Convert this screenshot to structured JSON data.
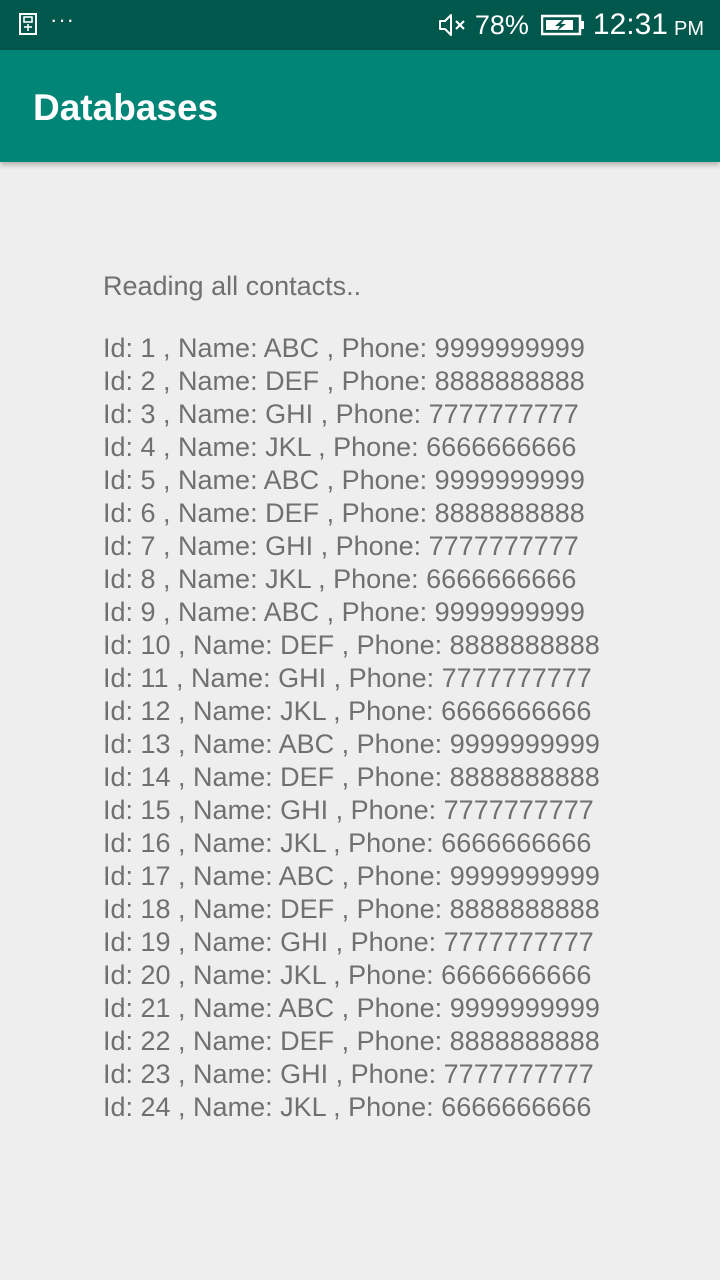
{
  "status_bar": {
    "icons_left": [
      "usb-icon",
      "more-dots-icon"
    ],
    "icons_right": [
      "mute-icon",
      "battery-charging-icon"
    ],
    "battery": "78%",
    "time": "12:31",
    "ampm": "PM"
  },
  "app_bar": {
    "title": "Databases",
    "color": "#008577"
  },
  "content": {
    "heading": "Reading all contacts..",
    "contacts": [
      "Id: 1 , Name: ABC , Phone: 9999999999",
      "Id: 2 , Name: DEF , Phone: 8888888888",
      "Id: 3 , Name: GHI , Phone: 7777777777",
      "Id: 4 , Name: JKL , Phone: 6666666666",
      "Id: 5 , Name: ABC , Phone: 9999999999",
      "Id: 6 , Name: DEF , Phone: 8888888888",
      "Id: 7 , Name: GHI , Phone: 7777777777",
      "Id: 8 , Name: JKL , Phone: 6666666666",
      "Id: 9 , Name: ABC , Phone: 9999999999",
      "Id: 10 , Name: DEF , Phone: 8888888888",
      "Id: 11 , Name: GHI , Phone: 7777777777",
      "Id: 12 , Name: JKL , Phone: 6666666666",
      "Id: 13 , Name: ABC , Phone: 9999999999",
      "Id: 14 , Name: DEF , Phone: 8888888888",
      "Id: 15 , Name: GHI , Phone: 7777777777",
      "Id: 16 , Name: JKL , Phone: 6666666666",
      "Id: 17 , Name: ABC , Phone: 9999999999",
      "Id: 18 , Name: DEF , Phone: 8888888888",
      "Id: 19 , Name: GHI , Phone: 7777777777",
      "Id: 20 , Name: JKL , Phone: 6666666666",
      "Id: 21 , Name: ABC , Phone: 9999999999",
      "Id: 22 , Name: DEF , Phone: 8888888888",
      "Id: 23 , Name: GHI , Phone: 7777777777",
      "Id: 24 , Name: JKL , Phone: 6666666666"
    ]
  }
}
